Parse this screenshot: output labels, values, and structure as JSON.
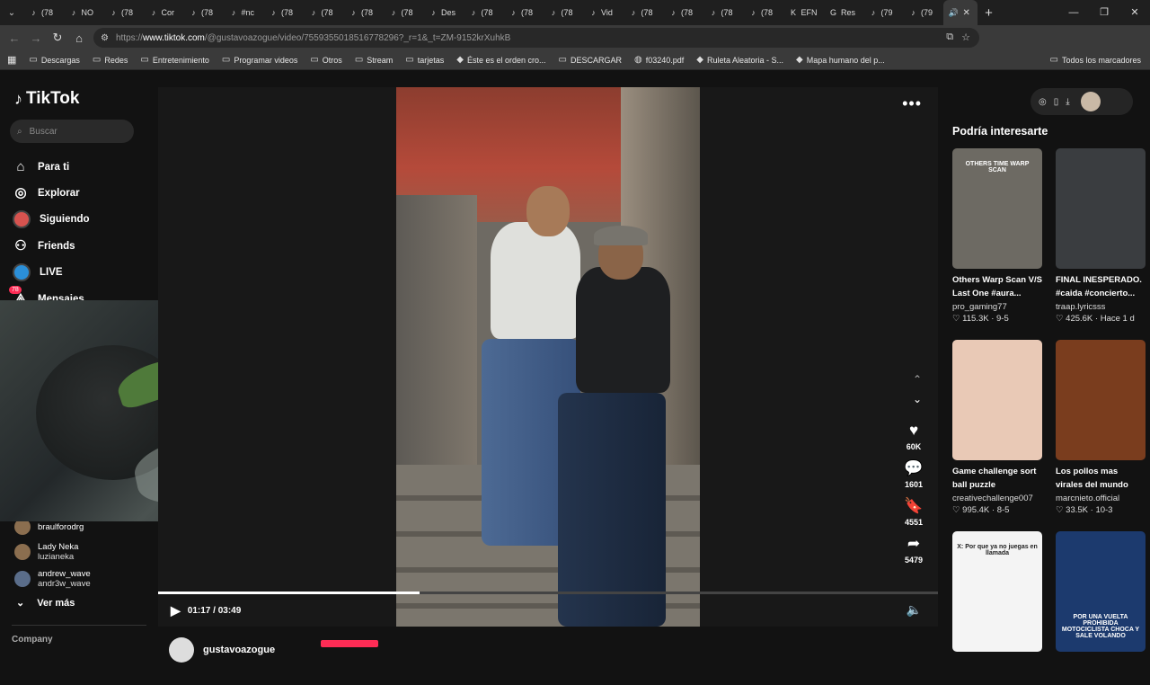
{
  "tabs": [
    {
      "label": "(78",
      "fav": "♪"
    },
    {
      "label": "NO",
      "fav": "♪"
    },
    {
      "label": "(78",
      "fav": "♪"
    },
    {
      "label": "Cor",
      "fav": "♪"
    },
    {
      "label": "(78",
      "fav": "♪"
    },
    {
      "label": "#nc",
      "fav": "♪"
    },
    {
      "label": "(78",
      "fav": "♪"
    },
    {
      "label": "(78",
      "fav": "♪"
    },
    {
      "label": "(78",
      "fav": "♪"
    },
    {
      "label": "(78",
      "fav": "♪"
    },
    {
      "label": "Des",
      "fav": "♪"
    },
    {
      "label": "(78",
      "fav": "♪"
    },
    {
      "label": "(78",
      "fav": "♪"
    },
    {
      "label": "(78",
      "fav": "♪"
    },
    {
      "label": "Vid",
      "fav": "♪"
    },
    {
      "label": "(78",
      "fav": "♪"
    },
    {
      "label": "(78",
      "fav": "♪"
    },
    {
      "label": "(78",
      "fav": "♪"
    },
    {
      "label": "(78",
      "fav": "♪"
    },
    {
      "label": "EFN",
      "fav": "K"
    },
    {
      "label": "Res",
      "fav": "G"
    },
    {
      "label": "(79",
      "fav": "♪"
    },
    {
      "label": "(79",
      "fav": "♪"
    }
  ],
  "active_tab": {
    "fav": "🔊"
  },
  "url": {
    "prefix": "https://",
    "host": "www.tiktok.com",
    "path": "/@gustavoazogue/video/7559355018516778296?_r=1&_t=ZM-9152krXuhkB"
  },
  "bookmarks": [
    {
      "icon": "folder-icon",
      "label": "Descargas"
    },
    {
      "icon": "folder-icon",
      "label": "Redes"
    },
    {
      "icon": "folder-icon",
      "label": "Entretenimiento"
    },
    {
      "icon": "folder-icon",
      "label": "Programar videos"
    },
    {
      "icon": "folder-icon",
      "label": "Otros"
    },
    {
      "icon": "folder-icon",
      "label": "Stream"
    },
    {
      "icon": "folder-icon",
      "label": "tarjetas"
    },
    {
      "icon": "page-icon",
      "label": "Éste es el orden cro..."
    },
    {
      "icon": "folder-icon",
      "label": "DESCARGAR"
    },
    {
      "icon": "globe-icon",
      "label": "f03240.pdf"
    },
    {
      "icon": "page-icon",
      "label": "Ruleta Aleatoria - S..."
    },
    {
      "icon": "page-icon",
      "label": "Mapa humano del p..."
    }
  ],
  "bookmarks_all": "Todos los marcadores",
  "tiktok": {
    "logo": "TikTok",
    "search_placeholder": "Buscar",
    "nav": [
      {
        "label": "Para ti",
        "icon": "home-icon"
      },
      {
        "label": "Explorar",
        "icon": "compass-icon"
      },
      {
        "label": "Siguiendo",
        "icon": "avatar-icon"
      },
      {
        "label": "Friends",
        "icon": "friends-icon"
      },
      {
        "label": "LIVE",
        "icon": "live-icon"
      },
      {
        "label": "Mensajes",
        "icon": "messages-icon"
      }
    ],
    "messages_badge": "78",
    "following": [
      {
        "name": "braulforodrg",
        "handle": ""
      },
      {
        "name": "Lady Neka",
        "handle": "luzianeka"
      },
      {
        "name": "andrew_wave",
        "handle": "andr3w_wave"
      }
    ],
    "ver_mas": "Ver más",
    "company": "Company"
  },
  "video": {
    "likes": "60K",
    "comments": "1601",
    "saves": "4551",
    "shares": "5479",
    "time": "01:17 / 03:49",
    "progress": 0.335,
    "author": "gustavoazogue"
  },
  "recommendations": {
    "title": "Podría interesarte",
    "items": [
      {
        "title": "Others Warp Scan V/S Last One #aura...",
        "author": "pro_gaming77",
        "likes": "115.3K",
        "age": "9-5",
        "thumb_text": "OTHERS TIME WARP SCAN",
        "color": "#6d6a63"
      },
      {
        "title": "FINAL INESPERADO. #caida #concierto...",
        "author": "traap.lyricsss",
        "likes": "425.6K",
        "age": "Hace 1 d",
        "thumb_text": "",
        "color": "#3a3d40"
      },
      {
        "title": "Game challenge sort ball puzzle",
        "author": "creativechallenge007",
        "likes": "995.4K",
        "age": "8-5",
        "thumb_text": "",
        "color": "#e9c9b6"
      },
      {
        "title": "Los pollos mas virales del mundo",
        "author": "marcnieto.official",
        "likes": "33.5K",
        "age": "10-3",
        "thumb_text": "",
        "color": "#7a3d1e"
      },
      {
        "title": "",
        "author": "",
        "likes": "",
        "age": "",
        "thumb_text": "X: Por que ya no juegas en llamada",
        "color": "#f4f4f4"
      },
      {
        "title": "",
        "author": "",
        "likes": "",
        "age": "",
        "thumb_text": "POR UNA VUELTA PROHIBIDA MOTOCICLISTA CHOCA Y SALE VOLANDO",
        "color": "#1c3a6e"
      }
    ]
  }
}
